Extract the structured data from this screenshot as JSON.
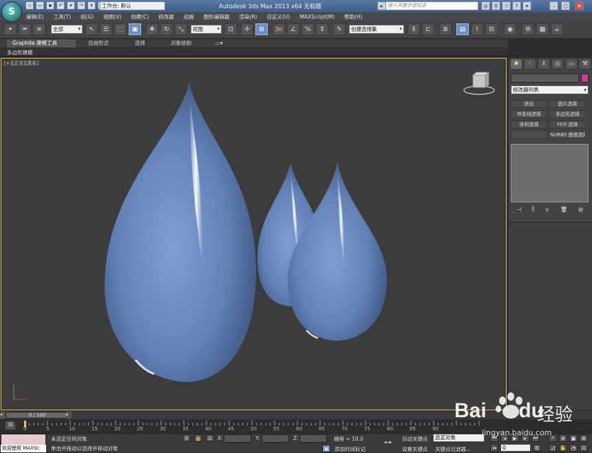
{
  "titlebar": {
    "workspace_label": "工作台: 默认",
    "title": "Autodesk 3ds Max  2013 x64     无标题",
    "search_placeholder": "键入关键字或短语"
  },
  "menu": [
    "编辑(E)",
    "工具(T)",
    "组(G)",
    "视图(V)",
    "创建(C)",
    "修改器",
    "动画",
    "图形编辑器",
    "渲染(R)",
    "自定义(U)",
    "MAXScript(M)",
    "帮助(H)"
  ],
  "toolbar": {
    "selection_filter": "全部",
    "ref_coord": "视图",
    "named_selection": "创建选择集",
    "snap_label": "3n"
  },
  "ribbon": {
    "tabs": [
      "Graphite 建模工具",
      "自由形式",
      "选择",
      "对象绘制"
    ],
    "sub_label": "多边形建模"
  },
  "viewport": {
    "label": "[+][正交][真实]"
  },
  "command_panel": {
    "modifier_list": "修改器列表",
    "buttons": [
      "挤出",
      "面片选择",
      "样条线选择",
      "多边形选择",
      "体积选择",
      "FFD 选择",
      "",
      "NURBS 曲面选择"
    ],
    "object_color": "#d1389a"
  },
  "timeline": {
    "frame_display": "0 / 100",
    "ticks": [
      "0",
      "5",
      "10",
      "15",
      "20",
      "25",
      "30",
      "35",
      "40",
      "45",
      "50",
      "55",
      "60",
      "65",
      "70",
      "75",
      "80",
      "85",
      "90"
    ]
  },
  "status": {
    "welcome": "欢迎使用 MAXSc",
    "selection_status": "未选定任何对象",
    "prompt": "单击并拖动以选择并移动对象",
    "x_label": "X:",
    "y_label": "Y:",
    "z_label": "Z:",
    "grid": "栅格 = 10.0",
    "add_time_tag": "添加时间标记",
    "auto_key": "自动关键点",
    "selected_object": "选定对象",
    "set_key": "设置关键点",
    "key_filters": "关键点过滤器...",
    "frame_value": "0"
  },
  "watermark": {
    "brand": "Bai",
    "brand2": "du",
    "cn": "经验",
    "url": "jingyan.baidu.com"
  }
}
